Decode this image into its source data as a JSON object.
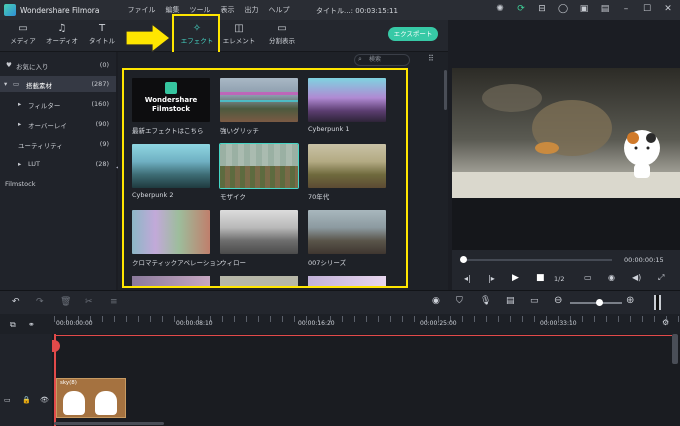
{
  "titlebar": {
    "app_name": "Wondershare Filmora",
    "menu": [
      "ファイル",
      "編集",
      "ツール",
      "表示",
      "出力",
      "ヘルプ"
    ],
    "doc_title": "タイトル...: 00:03:15:11"
  },
  "tabs": [
    {
      "label": "メディア",
      "icon": "folder-icon"
    },
    {
      "label": "オーディオ",
      "icon": "music-icon"
    },
    {
      "label": "タイトル",
      "icon": "text-icon"
    },
    {
      "label": "エフェクト",
      "icon": "effects-icon"
    },
    {
      "label": "エレメント",
      "icon": "element-icon"
    },
    {
      "label": "分割表示",
      "icon": "split-icon"
    }
  ],
  "export_label": "エクスポート",
  "sidebar": {
    "items": [
      {
        "label": "お気に入り",
        "count": "(0)"
      },
      {
        "label": "搭載素材",
        "count": "(287)"
      },
      {
        "label": "フィルター",
        "count": "(160)"
      },
      {
        "label": "オーバーレイ",
        "count": "(90)"
      },
      {
        "label": "ユーティリティ",
        "count": "(9)"
      },
      {
        "label": "LUT",
        "count": "(28)"
      }
    ],
    "filmstock_label": "Filmstock"
  },
  "search": {
    "placeholder": "検索"
  },
  "effects": [
    {
      "label": "最新エフェクトはこちら",
      "banner_line1": "Wondershare",
      "banner_line2": "Filmstock"
    },
    {
      "label": "強いグリッチ"
    },
    {
      "label": "Cyberpunk 1"
    },
    {
      "label": "Cyberpunk 2"
    },
    {
      "label": "モザイク"
    },
    {
      "label": "70年代"
    },
    {
      "label": "クロマティックアベレーション"
    },
    {
      "label": "ウィロー"
    },
    {
      "label": "007シリーズ"
    }
  ],
  "player": {
    "timecode": "00:00:00:15",
    "quality": "1/2"
  },
  "timeline": {
    "ticks": [
      "00:00:00:00",
      "00:00:08:10",
      "00:00:16:20",
      "00:00:25:00",
      "00:00:33:10"
    ],
    "clip_label": "sky(8)"
  },
  "accent_color": "#46d6c6",
  "highlight_color": "#ffe600"
}
